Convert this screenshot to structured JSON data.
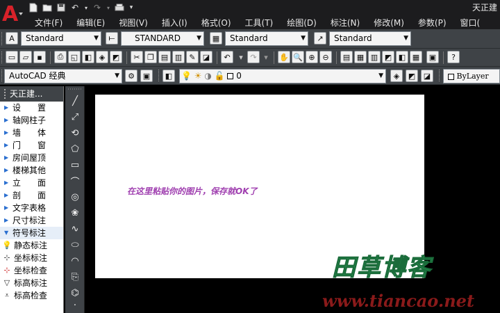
{
  "app": {
    "title_fragment": "天正建",
    "logo_letter": "A"
  },
  "quick_access": {
    "icons": [
      "new-icon",
      "open-icon",
      "save-icon",
      "undo-icon",
      "redo-icon",
      "plot-icon",
      "dropdown-icon"
    ]
  },
  "menubar": {
    "items": [
      "文件(F)",
      "编辑(E)",
      "视图(V)",
      "插入(I)",
      "格式(O)",
      "工具(T)",
      "绘图(D)",
      "标注(N)",
      "修改(M)",
      "参数(P)",
      "窗口("
    ]
  },
  "styles_toolbar": {
    "text_style": "Standard",
    "dim_style": "STANDARD",
    "table_style": "Standard",
    "multileader_style": "Standard"
  },
  "layers_toolbar": {
    "workspace": "AutoCAD 经典",
    "layer_name": "0",
    "color_control": "ByLayer"
  },
  "tz_panel": {
    "title": "天正建...",
    "items": [
      "设　　置",
      "轴网柱子",
      "墙　　体",
      "门　　窗",
      "房间屋顶",
      "楼梯其他",
      "立　　面",
      "剖　　面",
      "文字表格",
      "尺寸标注",
      "符号标注"
    ],
    "sub_items": [
      "静态标注",
      "坐标标注",
      "坐标检查",
      "标高标注",
      "标高检查"
    ]
  },
  "canvas": {
    "hint": "在这里粘贴你的图片，保存就OK了"
  },
  "watermark": {
    "logo_text": "田草博客",
    "url": "www.tiancao.net"
  }
}
